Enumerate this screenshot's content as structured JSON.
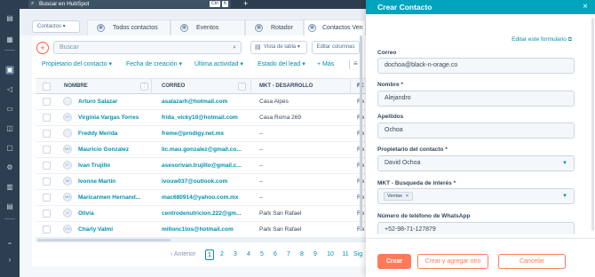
{
  "topbar": {
    "search_text": "Buscar en HubSpot",
    "kbd_ctrl": "Ctrl",
    "kbd_k": "K",
    "plus": "+"
  },
  "tabs": {
    "object_selector": "Contactos ▾",
    "items": [
      {
        "label": "Todos contactos",
        "icon": "table-icon"
      },
      {
        "label": "Eventos",
        "icon": "table-icon"
      },
      {
        "label": "Rotador",
        "icon": "table-icon"
      },
      {
        "label": "Contactos Ven",
        "icon": "table-icon"
      }
    ]
  },
  "toolbar": {
    "search_placeholder": "Buscar",
    "view_label": "Vista de tabla ▾",
    "edit_columns": "Editar columnas"
  },
  "filters": [
    "Propietario del contacto ▾",
    "Fecha de creación ▾",
    "Última actividad ▾",
    "Estado del lead ▾",
    "+ Más"
  ],
  "table": {
    "headers": [
      "NOMBRE",
      "CORREO",
      "MKT - DESARROLLO",
      "FE"
    ],
    "rows": [
      {
        "initials": "",
        "name": "Arturo Salazar",
        "email": "asalazarh@hotmail.com",
        "mkt": "Casa Alpes",
        "next": "Re"
      },
      {
        "initials": "VT",
        "name": "Virginia Vargas Torres",
        "email": "frida_vicky10@hotmail.com",
        "mkt": "Casa Roma 269",
        "next": "Re"
      },
      {
        "initials": "",
        "name": "Freddy Merida",
        "email": "freme@prodigy.net.mx",
        "mkt": "--",
        "next": "Re"
      },
      {
        "initials": "MG",
        "name": "Mauricio Gonzalez",
        "email": "lic.mau.gonzalez@gmail.co...",
        "mkt": "--",
        "next": "Re"
      },
      {
        "initials": "IT",
        "name": "Ivan Trujillo",
        "email": "asesorivan.trujillo@gmail.c...",
        "mkt": "--",
        "next": "Re"
      },
      {
        "initials": "IM",
        "name": "Ivonne Martin",
        "email": "ivouw037@outlook.com",
        "mkt": "--",
        "next": "Re"
      },
      {
        "initials": "MH",
        "name": "Maricarmen Hernand...",
        "email": "mac680914@yahoo.com.mx",
        "mkt": "--",
        "next": "Re"
      },
      {
        "initials": "O",
        "name": "Olivia",
        "email": "centrodenutricion.222@gm...",
        "mkt": "Park San Rafael",
        "next": "Re"
      },
      {
        "initials": "CV",
        "name": "Charly Valmi",
        "email": "millonc1tos@hotmail.com",
        "mkt": "Park San Rafael",
        "next": "Re"
      }
    ]
  },
  "pagination": {
    "prev": "Anterior",
    "pages": [
      "1",
      "2",
      "3",
      "4",
      "5",
      "6",
      "7",
      "8",
      "9",
      "10",
      "11"
    ],
    "current": "1",
    "next": "Sig"
  },
  "drawer": {
    "title": "Crear Contacto",
    "close": "×",
    "edit_form_link": "Editar este formulario",
    "fields": [
      {
        "label": "Correo",
        "value": "dochoa@black-n-orage.co"
      },
      {
        "label": "Nombre *",
        "value": "Alejandro"
      },
      {
        "label": "Apellidos",
        "value": "Ochoa"
      },
      {
        "label": "Propietario del contacto *",
        "value": "David Ochoa"
      },
      {
        "label": "MKT - Busqueda de interés *",
        "value": "Ventas"
      },
      {
        "label": "Número de teléfono de WhatsApp",
        "value": "+52-98-71-127879"
      }
    ],
    "buttons": {
      "create": "Crear",
      "create_another": "Crear y agregar otro",
      "cancel": "Cancelar"
    }
  },
  "colors": {
    "accent": "#ff7a59",
    "drawer_header": "#00a4bd",
    "link": "#0091ae",
    "nav": "#2d3e50"
  }
}
